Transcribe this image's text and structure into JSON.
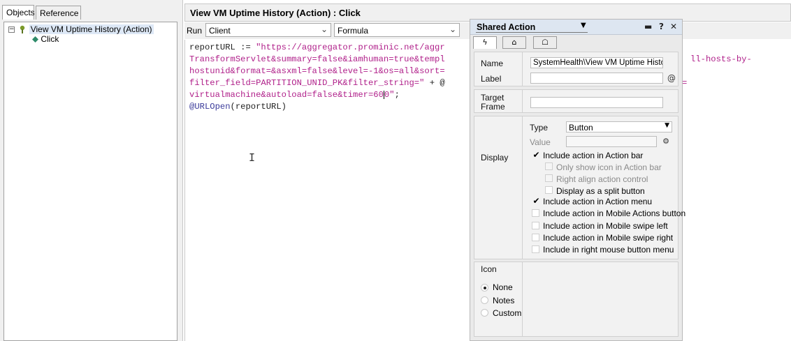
{
  "left_tabs": [
    {
      "label": "Objects"
    },
    {
      "label": "Reference"
    }
  ],
  "tree": {
    "expander": "−",
    "root_label": "View VM Uptime History (Action)",
    "child_label": "Click"
  },
  "title": "View VM Uptime History (Action) : Click",
  "run": {
    "label": "Run",
    "target_value": "Client",
    "language_value": "Formula"
  },
  "code": {
    "line1_a": "reportURL := ",
    "line1_b": "\"https://aggregator.prominic.net/aggr",
    "line2": "TransformServlet&summary=false&iamhuman=true&templ",
    "line3": "hostunid&format=&asxml=false&level=-1&os=all&sort=",
    "line4_a": "filter_field=PARTITION_UNID_PK&filter_string=\"",
    "line4_b": " + @",
    "line5_a": "virtualmachine&autoload=false&timer=60",
    "line5_b": "0\"",
    "line5_c": ";",
    "line6_a": "@URLOpen",
    "line6_b": "(reportURL)",
    "right1": "ll-hosts-by-",
    "right2": "="
  },
  "panel": {
    "title": "Shared Action",
    "icons": [
      "pin-icon",
      "help-icon",
      "close-icon"
    ],
    "tab_icons": [
      "lightning-icon",
      "hat-icon",
      "robot-icon"
    ],
    "name_label": "Name",
    "name_value": "SystemHealth\\View VM Uptime History",
    "label_label": "Label",
    "label_value": "",
    "target_label_1": "Target",
    "target_label_2": "Frame",
    "target_value": "",
    "display_label": "Display",
    "type_label": "Type",
    "type_value": "Button",
    "value_label": "Value",
    "value_value": "",
    "checks": [
      {
        "label": "Include action in Action bar",
        "checked": true,
        "disabled": false
      },
      {
        "label": "Only show icon in Action bar",
        "checked": false,
        "disabled": true
      },
      {
        "label": "Right align action control",
        "checked": false,
        "disabled": true
      },
      {
        "label": "Display as a split button",
        "checked": false,
        "disabled": false
      },
      {
        "label": "Include action in Action menu",
        "checked": true,
        "disabled": false
      },
      {
        "label": "Include action in Mobile Actions button",
        "checked": false,
        "disabled": false
      },
      {
        "label": "Include action in Mobile swipe left",
        "checked": false,
        "disabled": false
      },
      {
        "label": "Include action in Mobile swipe right",
        "checked": false,
        "disabled": false
      },
      {
        "label": "Include in right mouse button menu",
        "checked": false,
        "disabled": false
      }
    ],
    "icon_label": "Icon",
    "icon_options": [
      {
        "label": "None",
        "selected": true
      },
      {
        "label": "Notes",
        "selected": false
      },
      {
        "label": "Custom",
        "selected": false
      }
    ]
  }
}
